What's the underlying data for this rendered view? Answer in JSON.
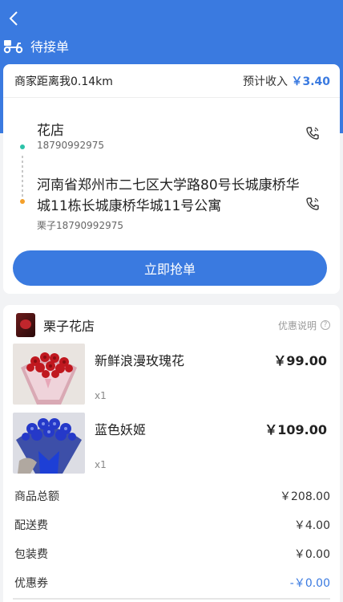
{
  "header": {
    "status_label": "待接单"
  },
  "order": {
    "distance_text": "商家距离我0.14km",
    "income_label": "预计收入",
    "income_amount": "￥3.40",
    "pickup": {
      "name": "花店",
      "phone": "18790992975"
    },
    "dropoff": {
      "address": "河南省郑州市二七区大学路80号长城康桥华城11栋长城康桥华城11号公寓",
      "contact": "栗子18790992975"
    },
    "grab_button": "立即抢单"
  },
  "shop": {
    "name": "栗子花店",
    "promo_label": "优惠说明",
    "promo_icon": "?"
  },
  "products": [
    {
      "name": "新鲜浪漫玫瑰花",
      "price": "￥99.00",
      "qty": "x1"
    },
    {
      "name": "蓝色妖姬",
      "price": "￥109.00",
      "qty": "x1"
    }
  ],
  "summary": [
    {
      "label": "商品总额",
      "value": "￥208.00"
    },
    {
      "label": "配送费",
      "value": "￥4.00"
    },
    {
      "label": "包装费",
      "value": "￥0.00"
    },
    {
      "label": "优惠券",
      "value": "-￥0.00"
    }
  ],
  "colors": {
    "accent": "#3a7ae0",
    "pickup_dot": "#2cc2a8",
    "dropoff_dot": "#f4a02a"
  },
  "icons": {
    "back": "chevron-left-icon",
    "status": "delivery-scooter-icon",
    "phone": "phone-call-icon"
  }
}
